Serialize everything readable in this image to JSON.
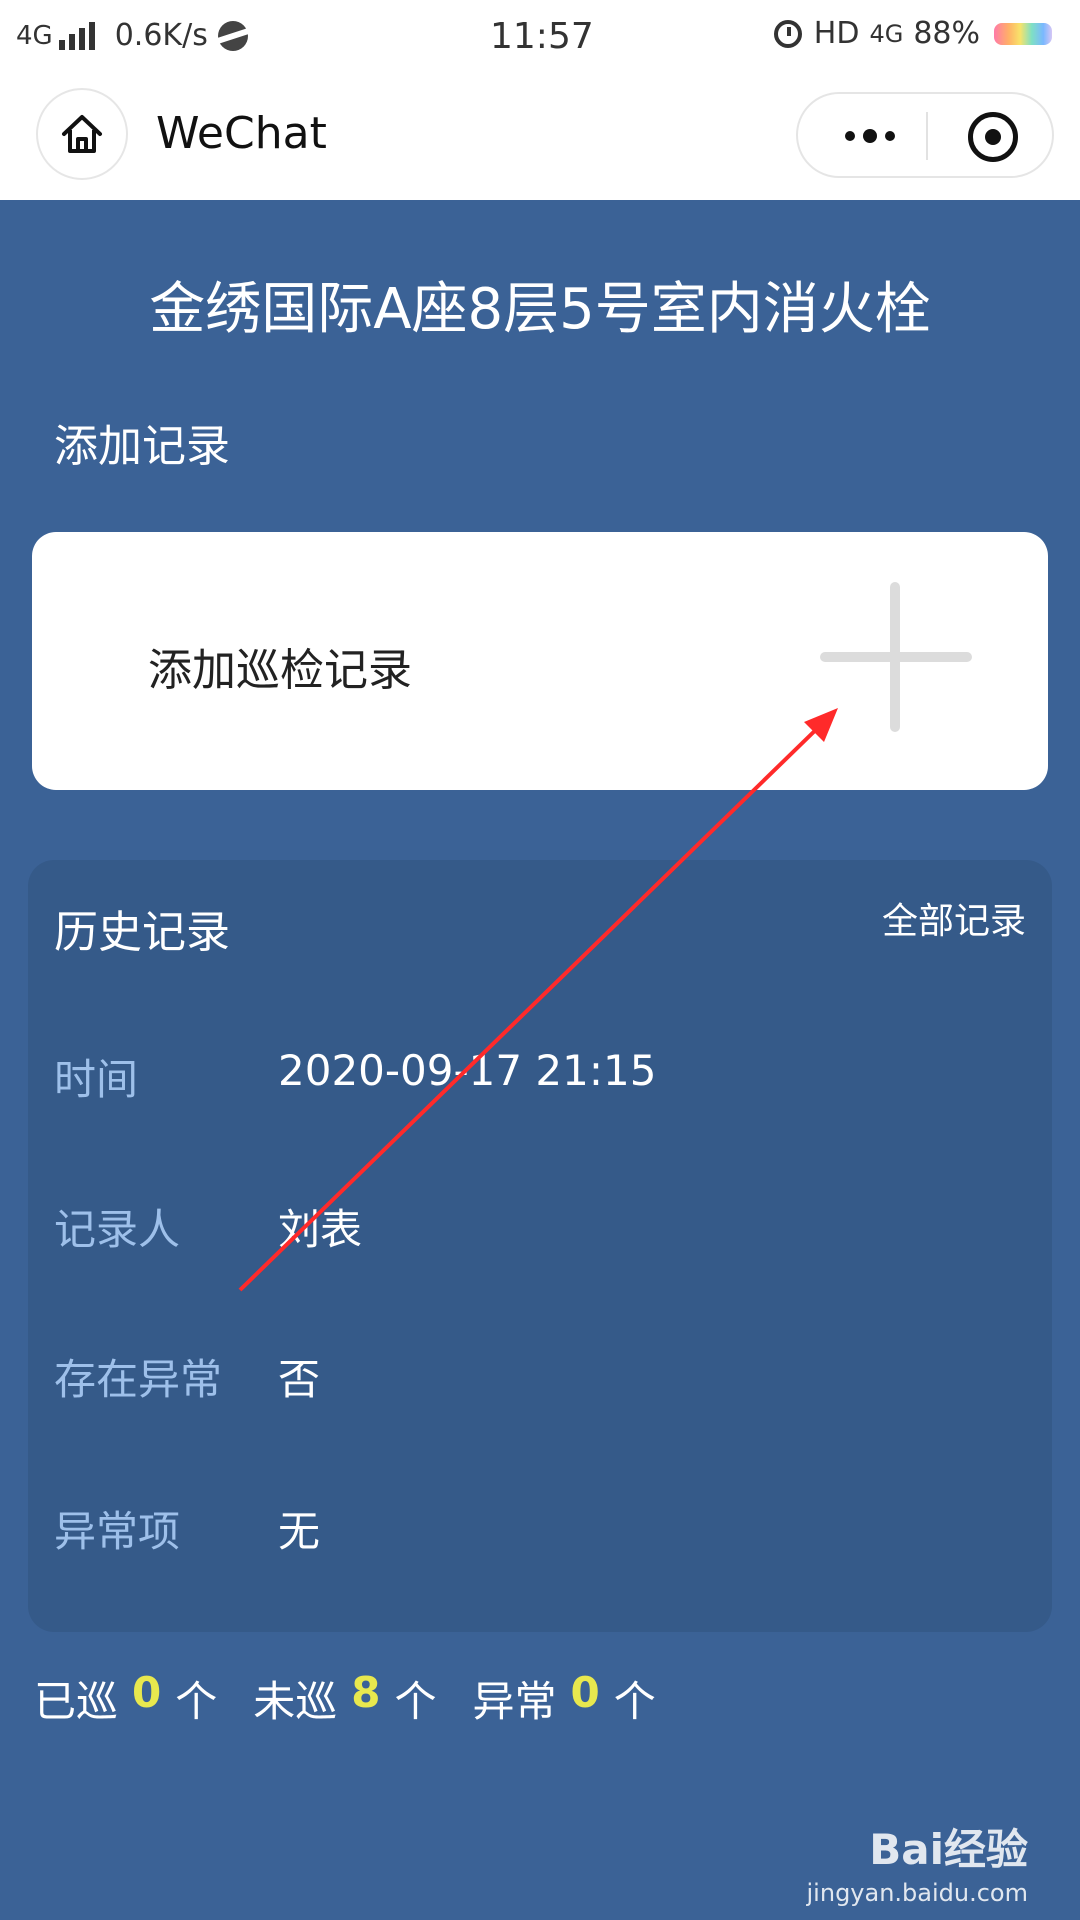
{
  "status_bar": {
    "network": "4G",
    "speed": "0.6K/s",
    "time": "11:57",
    "hd": "HD",
    "network_right": "4G",
    "battery": "88%"
  },
  "titlebar": {
    "app_name": "WeChat",
    "home_icon": "home-icon",
    "more_icon": "more-dots-icon",
    "close_icon": "target-close-icon"
  },
  "page": {
    "title": "金绣国际A座8层5号室内消火栓",
    "add_section_label": "添加记录",
    "add_card_label": "添加巡检记录",
    "add_icon": "plus-icon"
  },
  "history": {
    "title": "历史记录",
    "all_link": "全部记录",
    "rows": [
      {
        "label": "时间",
        "value": "2020-09-17 21:15"
      },
      {
        "label": "记录人",
        "value": "刘表"
      },
      {
        "label": "存在异常",
        "value": "否"
      },
      {
        "label": "异常项",
        "value": "无"
      }
    ]
  },
  "stats": {
    "patrolled_label": "已巡",
    "patrolled_count": "0",
    "unpatrolled_label": "未巡",
    "unpatrolled_count": "8",
    "abnormal_label": "异常",
    "abnormal_count": "0",
    "unit": "个"
  },
  "watermark": {
    "brand": "Bai经验",
    "url": "jingyan.baidu.com"
  },
  "colors": {
    "background": "#3b6296",
    "history_card": "#355a89",
    "stat_number": "#e8e84e",
    "label_blue": "#9ec0ea",
    "arrow": "#ff2a2a"
  }
}
